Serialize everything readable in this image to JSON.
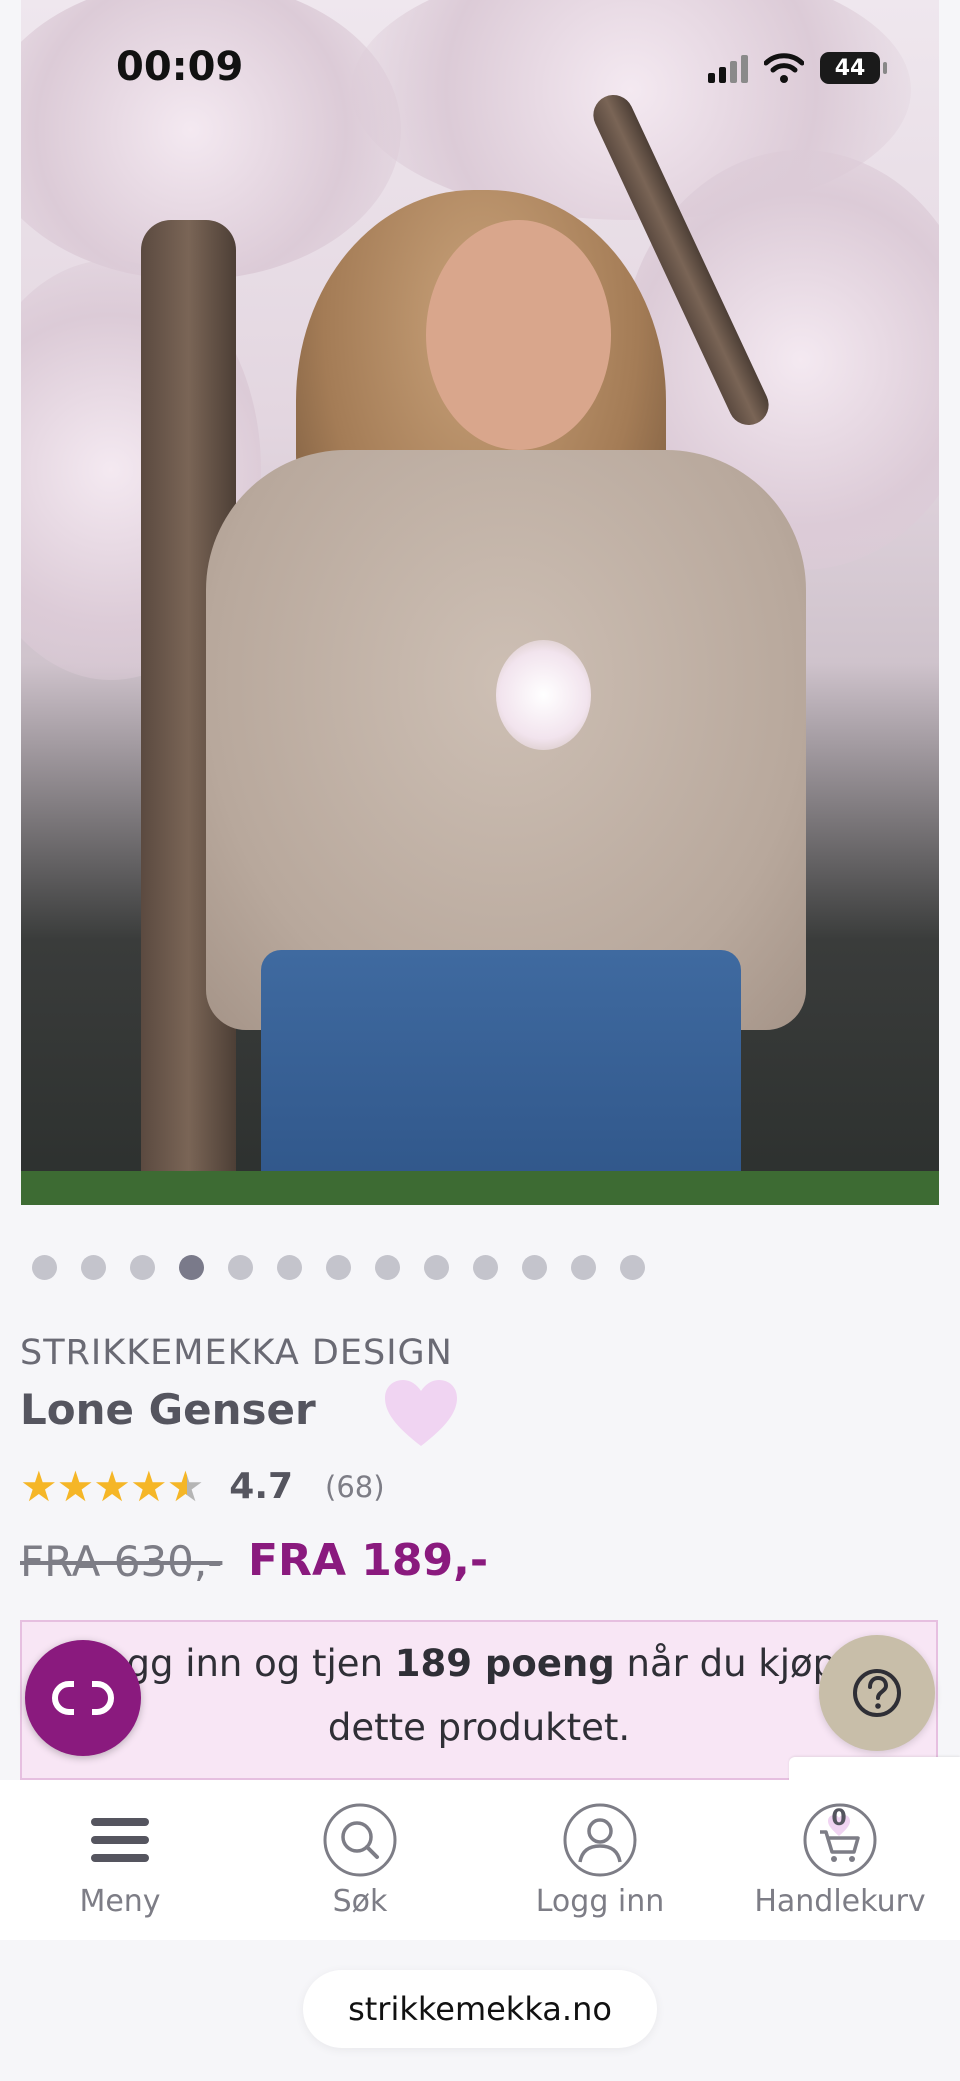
{
  "status_bar": {
    "time": "00:09",
    "battery": "44"
  },
  "carousel": {
    "count": 13,
    "active_index": 3
  },
  "product": {
    "brand": "STRIKKEMEKKA DESIGN",
    "name": "Lone Genser",
    "rating": 4.7,
    "rating_value": "4.7",
    "rating_count": "(68)",
    "price_old": "FRA 630,-",
    "price_new": "FRA 189,-"
  },
  "points": {
    "prefix": "Logg inn og tjen ",
    "highlight": "189 poeng",
    "suffix": " når du kjøper",
    "line2": "dette produktet."
  },
  "bottom_nav": {
    "menu": "Meny",
    "search": "Søk",
    "login": "Logg inn",
    "cart": "Handlekurv",
    "cart_count": "0"
  },
  "browser": {
    "url": "strikkemekka.no"
  },
  "colors": {
    "accent": "#8a1a7e",
    "star": "#f5b627",
    "heart": "#f0d4f2",
    "help": "#c8bea9"
  }
}
